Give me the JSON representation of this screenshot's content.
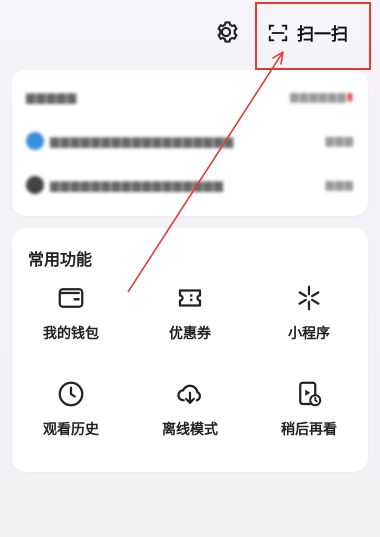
{
  "header": {
    "scan_label": "扫一扫",
    "icons": [
      "gear-icon",
      "scan-icon"
    ]
  },
  "colors": {
    "highlight": "#e53935",
    "page_bg": "#f3f2f7",
    "card_bg": "#ffffff",
    "text": "#222222"
  },
  "functions": {
    "title": "常用功能",
    "items": [
      {
        "label": "我的钱包",
        "icon": "wallet-icon"
      },
      {
        "label": "优惠券",
        "icon": "coupon-icon"
      },
      {
        "label": "小程序",
        "icon": "mini-program-icon"
      },
      {
        "label": "观看历史",
        "icon": "clock-icon"
      },
      {
        "label": "离线模式",
        "icon": "cloud-download-icon"
      },
      {
        "label": "稍后再看",
        "icon": "watch-later-icon"
      }
    ]
  }
}
